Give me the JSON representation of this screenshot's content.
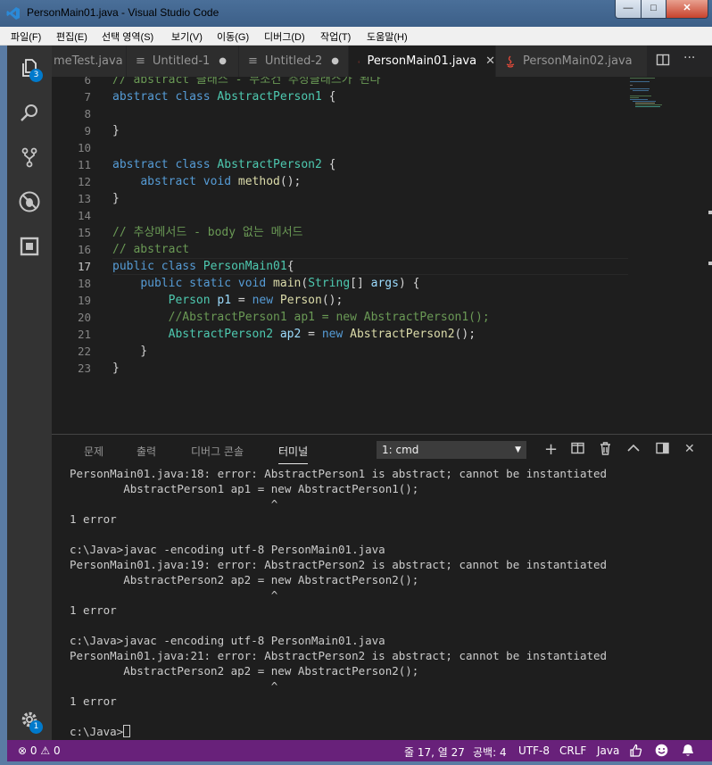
{
  "window": {
    "title": "PersonMain01.java - Visual Studio Code",
    "controls": {
      "minimize": "—",
      "maximize": "□",
      "close": "✕"
    }
  },
  "menu": [
    "파일(F)",
    "편집(E)",
    "선택 영역(S)",
    "보기(V)",
    "이동(G)",
    "디버그(D)",
    "작업(T)",
    "도움말(H)"
  ],
  "activity_bar": {
    "explorer_badge": "3",
    "manage_badge": "1"
  },
  "tabs": [
    {
      "label": "meTest.java",
      "icon": "java-icon",
      "state": ""
    },
    {
      "label": "Untitled-1",
      "icon": "text-icon",
      "state": "●"
    },
    {
      "label": "Untitled-2",
      "icon": "text-icon",
      "state": "●"
    },
    {
      "label": "PersonMain01.java",
      "icon": "java-icon",
      "state": "✕"
    },
    {
      "label": "PersonMain02.java",
      "icon": "java-icon",
      "state": ""
    }
  ],
  "editor": {
    "current_line": 17,
    "lines": [
      {
        "n": "6",
        "segs": [
          [
            "cm",
            "// abstract 클래스 - 무조건 추상클래스가 된다"
          ]
        ]
      },
      {
        "n": "7",
        "segs": [
          [
            "kw",
            "abstract"
          ],
          [
            "pl",
            " "
          ],
          [
            "kw",
            "class"
          ],
          [
            "pl",
            " "
          ],
          [
            "ty",
            "AbstractPerson1"
          ],
          [
            "pl",
            " {"
          ]
        ]
      },
      {
        "n": "8",
        "segs": []
      },
      {
        "n": "9",
        "segs": [
          [
            "pl",
            "}"
          ]
        ]
      },
      {
        "n": "10",
        "segs": []
      },
      {
        "n": "11",
        "segs": [
          [
            "kw",
            "abstract"
          ],
          [
            "pl",
            " "
          ],
          [
            "kw",
            "class"
          ],
          [
            "pl",
            " "
          ],
          [
            "ty",
            "AbstractPerson2"
          ],
          [
            "pl",
            " {"
          ]
        ]
      },
      {
        "n": "12",
        "segs": [
          [
            "pl",
            "    "
          ],
          [
            "kw",
            "abstract"
          ],
          [
            "pl",
            " "
          ],
          [
            "kw",
            "void"
          ],
          [
            "pl",
            " "
          ],
          [
            "fn",
            "method"
          ],
          [
            "pl",
            "();"
          ]
        ]
      },
      {
        "n": "13",
        "segs": [
          [
            "pl",
            "}"
          ]
        ]
      },
      {
        "n": "14",
        "segs": []
      },
      {
        "n": "15",
        "segs": [
          [
            "cm",
            "// 추상메서드 - body 없는 메서드"
          ]
        ]
      },
      {
        "n": "16",
        "segs": [
          [
            "cm",
            "// abstract"
          ]
        ]
      },
      {
        "n": "17",
        "segs": [
          [
            "kw",
            "public"
          ],
          [
            "pl",
            " "
          ],
          [
            "kw",
            "class"
          ],
          [
            "pl",
            " "
          ],
          [
            "ty",
            "PersonMain01"
          ],
          [
            "pl",
            "{"
          ]
        ]
      },
      {
        "n": "18",
        "segs": [
          [
            "pl",
            "    "
          ],
          [
            "kw",
            "public"
          ],
          [
            "pl",
            " "
          ],
          [
            "kw",
            "static"
          ],
          [
            "pl",
            " "
          ],
          [
            "kw",
            "void"
          ],
          [
            "pl",
            " "
          ],
          [
            "fn",
            "main"
          ],
          [
            "pl",
            "("
          ],
          [
            "ty",
            "String"
          ],
          [
            "pl",
            "[] "
          ],
          [
            "va",
            "args"
          ],
          [
            "pl",
            ") {"
          ]
        ]
      },
      {
        "n": "19",
        "segs": [
          [
            "pl",
            "        "
          ],
          [
            "ty",
            "Person"
          ],
          [
            "pl",
            " "
          ],
          [
            "va",
            "p1"
          ],
          [
            "pl",
            " = "
          ],
          [
            "kw",
            "new"
          ],
          [
            "pl",
            " "
          ],
          [
            "fn",
            "Person"
          ],
          [
            "pl",
            "();"
          ]
        ]
      },
      {
        "n": "20",
        "segs": [
          [
            "pl",
            "        "
          ],
          [
            "cm",
            "//AbstractPerson1 ap1 = new AbstractPerson1();"
          ]
        ]
      },
      {
        "n": "21",
        "segs": [
          [
            "pl",
            "        "
          ],
          [
            "ty",
            "AbstractPerson2"
          ],
          [
            "pl",
            " "
          ],
          [
            "va",
            "ap2"
          ],
          [
            "pl",
            " = "
          ],
          [
            "kw",
            "new"
          ],
          [
            "pl",
            " "
          ],
          [
            "fn",
            "AbstractPerson2"
          ],
          [
            "pl",
            "();"
          ]
        ]
      },
      {
        "n": "22",
        "segs": [
          [
            "pl",
            "    }"
          ]
        ]
      },
      {
        "n": "23",
        "segs": [
          [
            "pl",
            "}"
          ]
        ]
      }
    ]
  },
  "panel": {
    "tabs": [
      "문제",
      "출력",
      "디버그 콘솔",
      "터미널"
    ],
    "active_tab": "터미널",
    "terminal_select": "1: cmd",
    "terminal_lines": [
      "PersonMain01.java:18: error: AbstractPerson1 is abstract; cannot be instantiated",
      "        AbstractPerson1 ap1 = new AbstractPerson1();",
      "                              ^",
      "1 error",
      "",
      "c:\\Java>javac -encoding utf-8 PersonMain01.java",
      "PersonMain01.java:19: error: AbstractPerson2 is abstract; cannot be instantiated",
      "        AbstractPerson2 ap2 = new AbstractPerson2();",
      "                              ^",
      "1 error",
      "",
      "c:\\Java>javac -encoding utf-8 PersonMain01.java",
      "PersonMain01.java:21: error: AbstractPerson2 is abstract; cannot be instantiated",
      "        AbstractPerson2 ap2 = new AbstractPerson2();",
      "                              ^",
      "1 error",
      "",
      "c:\\Java>"
    ]
  },
  "status": {
    "errors": "0",
    "warnings": "0",
    "position": "줄 17, 열 27",
    "indent": "공백: 4",
    "encoding": "UTF-8",
    "eol": "CRLF",
    "language": "Java"
  },
  "colors": {
    "status_bar": "#68217a",
    "badge": "#007acc",
    "keyword": "#569cd6",
    "type": "#4ec9b0",
    "function": "#dcdcaa",
    "variable": "#9cdcfe",
    "comment": "#6a9955"
  }
}
